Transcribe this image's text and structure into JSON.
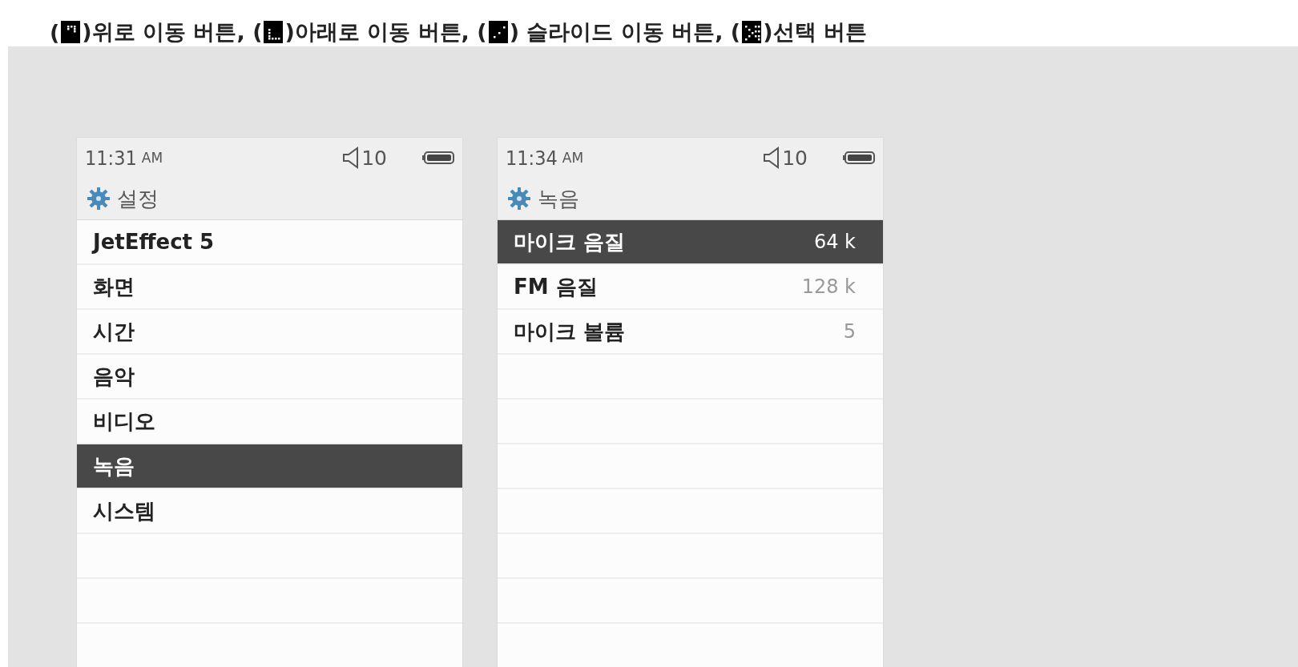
{
  "legend": [
    {
      "kind": "text",
      "text": "("
    },
    {
      "kind": "up"
    },
    {
      "kind": "text",
      "text": ")위로 이동 버튼, ("
    },
    {
      "kind": "down"
    },
    {
      "kind": "text",
      "text": ")아래로 이동 버튼, ("
    },
    {
      "kind": "slide"
    },
    {
      "kind": "text",
      "text": ") 슬라이드 이동 버튼, ("
    },
    {
      "kind": "select"
    },
    {
      "kind": "text",
      "text": ")선택 버튼"
    }
  ],
  "screens": [
    {
      "time": "11:31",
      "ampm": "AM",
      "volume": "10",
      "title": "설정",
      "items": [
        {
          "label": "JetEffect 5",
          "selected": false
        },
        {
          "label": "화면",
          "selected": false
        },
        {
          "label": "시간",
          "selected": false
        },
        {
          "label": "음악",
          "selected": false
        },
        {
          "label": "비디오",
          "selected": false
        },
        {
          "label": "녹음",
          "selected": true
        },
        {
          "label": "시스템",
          "selected": false
        }
      ]
    },
    {
      "time": "11:34",
      "ampm": "AM",
      "volume": "10",
      "title": "녹음",
      "items": [
        {
          "label": "마이크 음질",
          "value": "64 k",
          "selected": true
        },
        {
          "label": "FM 음질",
          "value": "128 k",
          "selected": false
        },
        {
          "label": "마이크 볼륨",
          "value": "5",
          "selected": false
        }
      ]
    }
  ]
}
